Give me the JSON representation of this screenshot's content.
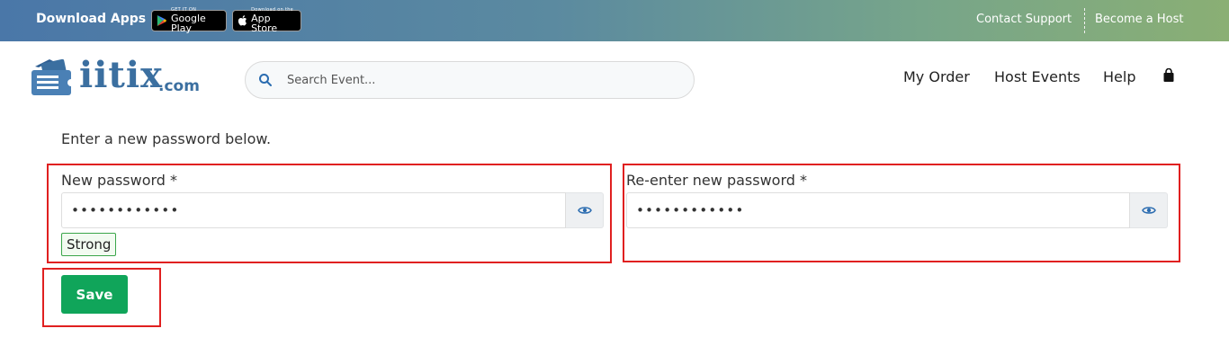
{
  "topbar": {
    "download_label": "Download Apps",
    "google_play": {
      "small": "GET IT ON",
      "big": "Google Play"
    },
    "app_store": {
      "small": "Download on the",
      "big": "App Store"
    },
    "contact_support": "Contact Support",
    "become_host": "Become a Host",
    "gradient_start": "#4a77a8",
    "gradient_end": "#8aaf74"
  },
  "header": {
    "logo_text": "iitix",
    "logo_domain": ".com",
    "search_placeholder": "Search Event...",
    "nav": {
      "my_order": "My Order",
      "host_events": "Host Events",
      "help": "Help"
    },
    "cart_icon": "shopping-bag-icon"
  },
  "form": {
    "intro": "Enter a new password below.",
    "new_password": {
      "label": "New password *",
      "value": "••••••••••••",
      "strength": "Strong"
    },
    "confirm_password": {
      "label": "Re-enter new password *",
      "value": "••••••••••••"
    },
    "save_label": "Save",
    "accent_color": "#10a55a",
    "highlight_color": "#e02020"
  }
}
